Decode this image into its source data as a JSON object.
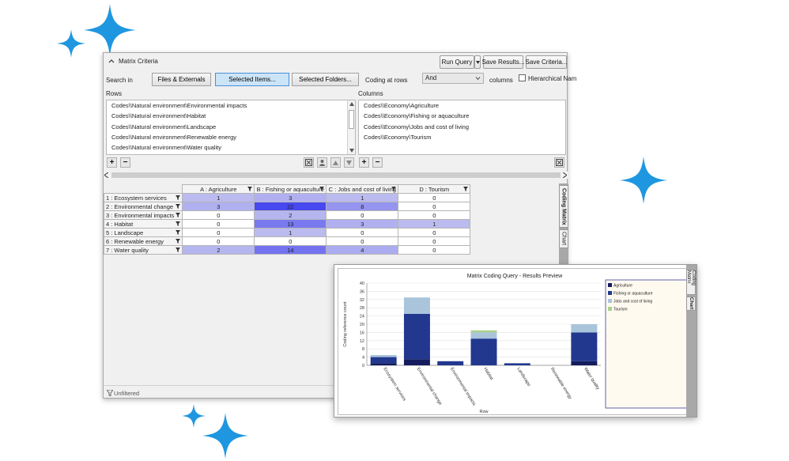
{
  "criteria": {
    "title": "Matrix Criteria",
    "run_query": "Run Query",
    "save_results": "Save Results...",
    "save_criteria": "Save Criteria...",
    "search_in_label": "Search in",
    "scope_buttons": [
      "Files & Externals",
      "Selected Items...",
      "Selected Folders..."
    ],
    "scope_selected": "Selected Items...",
    "coding_at_label": "Coding at rows",
    "operator": "And",
    "columns_label": "columns",
    "hierarchical_label": "Hierarchical Nam",
    "rows_label": "Rows",
    "columns_section_label": "Columns",
    "rows": [
      "Codes\\\\Natural environment\\Environmental impacts",
      "Codes\\\\Natural environment\\Habitat",
      "Codes\\\\Natural environment\\Landscape",
      "Codes\\\\Natural environment\\Renewable energy",
      "Codes\\\\Natural environment\\Water quality"
    ],
    "columns": [
      "Codes\\\\Economy\\Agriculture",
      "Codes\\\\Economy\\Fishing or aquaculture",
      "Codes\\\\Economy\\Jobs and cost of living",
      "Codes\\\\Economy\\Tourism"
    ],
    "add_label": "+",
    "remove_label": "−"
  },
  "matrix": {
    "column_headers": [
      "A : Agriculture",
      "B : Fishing or aquaculture",
      "C : Jobs and cost of living",
      "D : Tourism"
    ],
    "rows": [
      {
        "label": "1 : Ecosystem services",
        "values": [
          1,
          3,
          1,
          0
        ]
      },
      {
        "label": "2 : Environmental change",
        "values": [
          3,
          22,
          8,
          0
        ]
      },
      {
        "label": "3 : Environmental impacts",
        "values": [
          0,
          2,
          0,
          0
        ]
      },
      {
        "label": "4 : Habitat",
        "values": [
          0,
          13,
          3,
          1
        ]
      },
      {
        "label": "5 : Landscape",
        "values": [
          0,
          1,
          0,
          0
        ]
      },
      {
        "label": "6 : Renewable energy",
        "values": [
          0,
          0,
          0,
          0
        ]
      },
      {
        "label": "7 : Water quality",
        "values": [
          2,
          14,
          4,
          0
        ]
      }
    ],
    "max_shade_value": 22,
    "shade_color": "#4848f0"
  },
  "side_tabs": [
    "Coding Matrix",
    "Chart"
  ],
  "status": {
    "filter_text": "Unfiltered"
  },
  "chart_data": {
    "type": "bar",
    "stacked": true,
    "title": "Matrix Coding Query - Results Preview",
    "xlabel": "Row",
    "ylabel": "Coding reference count",
    "ylim": [
      0,
      40
    ],
    "yticks": [
      0,
      4,
      8,
      12,
      16,
      20,
      24,
      28,
      32,
      36,
      40
    ],
    "grid": true,
    "legend_position": "right",
    "categories": [
      "Ecosystem services",
      "Environmental change",
      "Environmental impacts",
      "Habitat",
      "Landscape",
      "Renewable energy",
      "Water quality"
    ],
    "series": [
      {
        "name": "Agriculture",
        "color": "#141c5e",
        "values": [
          1,
          3,
          0,
          0,
          0,
          0,
          2
        ]
      },
      {
        "name": "Fishing or aquaculture",
        "color": "#22388f",
        "values": [
          3,
          22,
          2,
          13,
          1,
          0,
          14
        ]
      },
      {
        "name": "Jobs and cost of living",
        "color": "#a9c4db",
        "values": [
          1,
          8,
          0,
          3,
          0,
          0,
          4
        ]
      },
      {
        "name": "Tourism",
        "color": "#a8d18d",
        "values": [
          0,
          0,
          0,
          1,
          0,
          0,
          0
        ]
      }
    ]
  },
  "colors": {
    "sparkle": "#1f97e0",
    "selected_bg": "#cce4f7"
  }
}
